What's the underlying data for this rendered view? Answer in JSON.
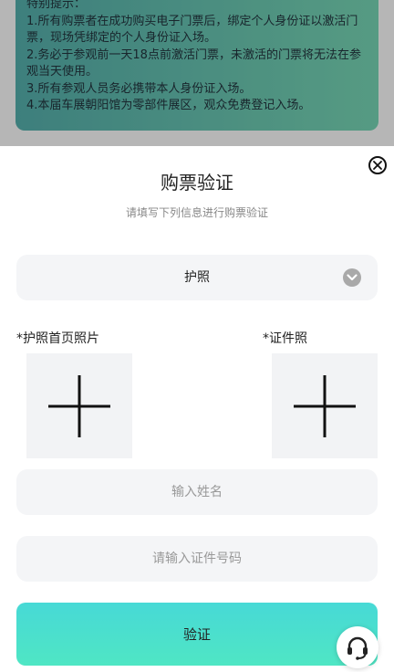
{
  "notice": {
    "title": "特别提示：",
    "lines": [
      "1.所有购票者在成功购买电子门票后，绑定个人身份证以激活门票，现场凭绑定的个人身份证入场。",
      "2.务必于参观前一天18点前激活门票，未激活的门票将无法在参观当天使用。",
      "3.所有参观人员务必携带本人身份证入场。",
      "4.本届车展朝阳馆为零部件展区，观众免费登记入场。"
    ]
  },
  "dialog": {
    "title": "购票验证",
    "subtitle": "请填写下列信息进行购票验证",
    "close_icon": "close-icon",
    "id_type": {
      "selected": "护照",
      "arrow_icon": "chevron-down-icon"
    },
    "uploads": [
      {
        "label": "*护照首页照片",
        "icon": "plus-icon"
      },
      {
        "label": "*证件照",
        "icon": "plus-icon"
      }
    ],
    "name_input": {
      "value": "",
      "placeholder": "输入姓名"
    },
    "id_number_input": {
      "value": "",
      "placeholder": "请输入证件号码"
    },
    "verify_label": "验证",
    "service_icon": "headset-icon"
  },
  "colors": {
    "accent_start": "#47d9d6",
    "accent_end": "#4fe6c4",
    "field_bg": "#f4f5f7"
  }
}
